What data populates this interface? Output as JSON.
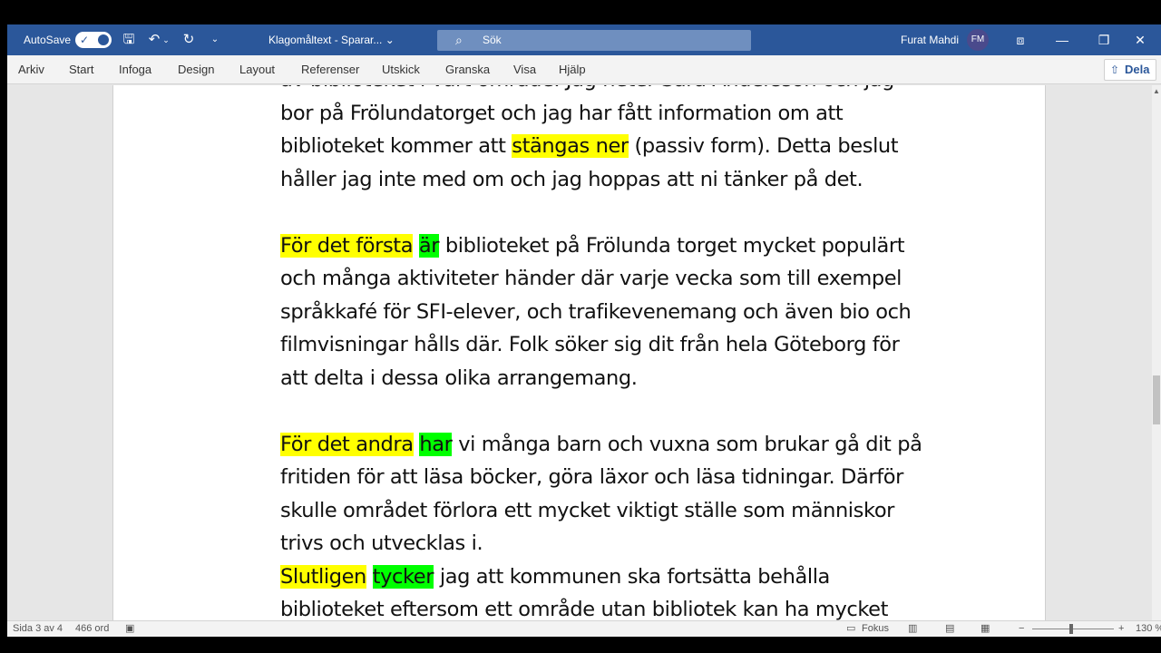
{
  "titlebar": {
    "autosave_label": "AutoSave",
    "doc_title": "Klagomåltext  -  Sparar...  ⌄",
    "search_placeholder": "Sök",
    "user_name": "Furat Mahdi",
    "user_initials": "FM"
  },
  "ribbon": {
    "tabs": [
      "Arkiv",
      "Start",
      "Infoga",
      "Design",
      "Layout",
      "Referenser",
      "Utskick",
      "Granska",
      "Visa",
      "Hjälp"
    ],
    "share_label": "Dela"
  },
  "document": {
    "lines": [
      {
        "segments": [
          {
            "text": "av biblioteket i vårt område. Jag heter Sara Andersson och jag"
          }
        ]
      },
      {
        "segments": [
          {
            "text": "bor på Frölundatorget och jag har fått information om att"
          }
        ]
      },
      {
        "segments": [
          {
            "text": "biblioteket kommer att "
          },
          {
            "text": "stängas ner",
            "hl": "yellow"
          },
          {
            "text": " (passiv form). Detta beslut"
          }
        ]
      },
      {
        "segments": [
          {
            "text": "håller jag inte med om och jag hoppas att ni tänker på det."
          }
        ]
      },
      {
        "gap": true
      },
      {
        "segments": [
          {
            "text": "För det första",
            "hl": "yellow"
          },
          {
            "text": " "
          },
          {
            "text": "är",
            "hl": "green"
          },
          {
            "text": " biblioteket på Frölunda torget mycket populärt"
          }
        ]
      },
      {
        "segments": [
          {
            "text": "och många aktiviteter händer där varje vecka som till exempel"
          }
        ]
      },
      {
        "segments": [
          {
            "text": "språkkafé för SFI-elever, och trafikevenemang och även bio och"
          }
        ]
      },
      {
        "segments": [
          {
            "text": "filmvisningar hålls där. Folk söker sig dit från hela Göteborg för"
          }
        ]
      },
      {
        "segments": [
          {
            "text": "att delta i dessa olika arrangemang."
          }
        ]
      },
      {
        "gap": true
      },
      {
        "segments": [
          {
            "text": "För det andra",
            "hl": "yellow"
          },
          {
            "text": " "
          },
          {
            "text": "har",
            "hl": "green"
          },
          {
            "text": " vi många barn och vuxna som brukar gå dit på"
          }
        ]
      },
      {
        "segments": [
          {
            "text": "fritiden för att läsa böcker, göra läxor och läsa tidningar. Därför"
          }
        ]
      },
      {
        "segments": [
          {
            "text": "skulle området förlora ett mycket viktigt ställe som människor"
          }
        ]
      },
      {
        "segments": [
          {
            "text": "trivs och utvecklas i."
          }
        ]
      },
      {
        "segments": [
          {
            "text": "Slutligen",
            "hl": "yellow"
          },
          {
            "text": " "
          },
          {
            "text": "tycker",
            "hl": "green"
          },
          {
            "text": " jag att kommunen ska fortsätta behålla"
          }
        ]
      },
      {
        "segments": [
          {
            "text": "biblioteket eftersom ett område utan bibliotek kan ha mycket"
          }
        ]
      }
    ]
  },
  "status": {
    "page": "Sida 3 av 4",
    "words": "466 ord",
    "focus": "Fokus",
    "zoom": "130 %"
  },
  "colors": {
    "titlebar": "#2b579a",
    "highlight_yellow": "#ffff00",
    "highlight_green": "#00ff00"
  }
}
